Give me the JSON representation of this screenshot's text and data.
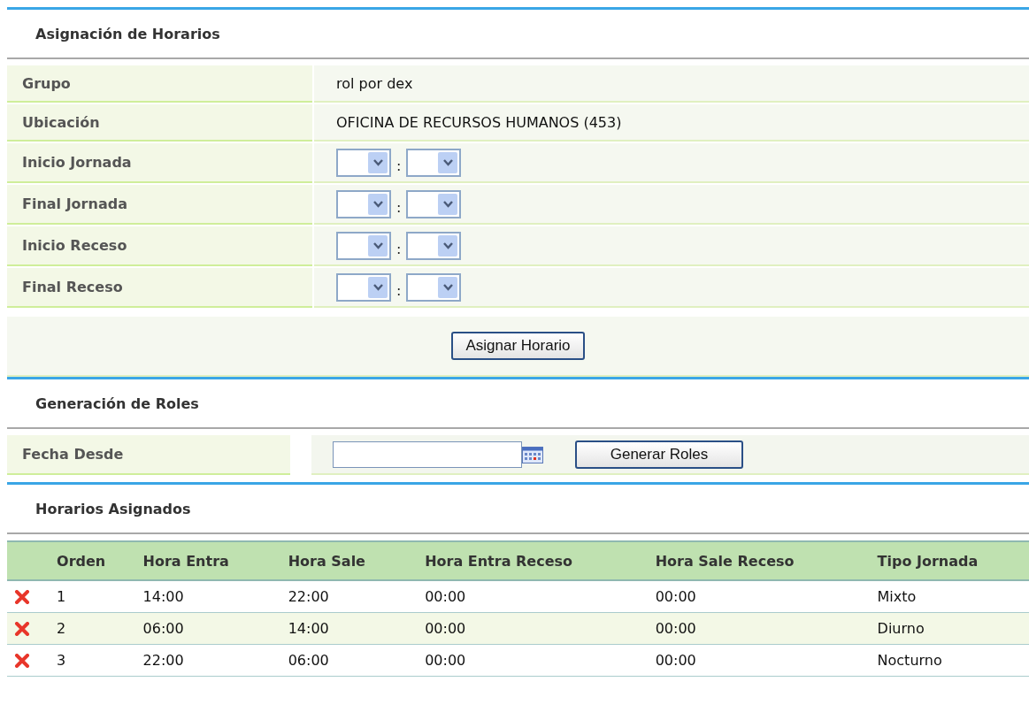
{
  "assign": {
    "title": "Asignación de Horarios",
    "fields": [
      {
        "kind": "text",
        "label": "Grupo",
        "value": "rol por dex"
      },
      {
        "kind": "text",
        "label": "Ubicación",
        "value": "OFICINA DE RECURSOS HUMANOS (453)"
      },
      {
        "kind": "time",
        "label": "Inicio Jornada",
        "separator": ":"
      },
      {
        "kind": "time",
        "label": "Final Jornada",
        "separator": ":"
      },
      {
        "kind": "time",
        "label": "Inicio Receso",
        "separator": ":"
      },
      {
        "kind": "time",
        "label": "Final Receso",
        "separator": ":"
      }
    ],
    "button": "Asignar Horario"
  },
  "roles": {
    "title": "Generación de Roles",
    "label": "Fecha Desde",
    "button": "Generar Roles"
  },
  "assigned": {
    "title": "Horarios Asignados",
    "columns": [
      "Orden",
      "Hora Entra",
      "Hora Sale",
      "Hora Entra Receso",
      "Hora Sale Receso",
      "Tipo Jornada"
    ],
    "rows": [
      {
        "cells": [
          "1",
          "14:00",
          "22:00",
          "00:00",
          "00:00",
          "Mixto"
        ]
      },
      {
        "cells": [
          "2",
          "06:00",
          "14:00",
          "00:00",
          "00:00",
          "Diurno"
        ]
      },
      {
        "cells": [
          "3",
          "22:00",
          "06:00",
          "00:00",
          "00:00",
          "Nocturno"
        ]
      }
    ]
  }
}
